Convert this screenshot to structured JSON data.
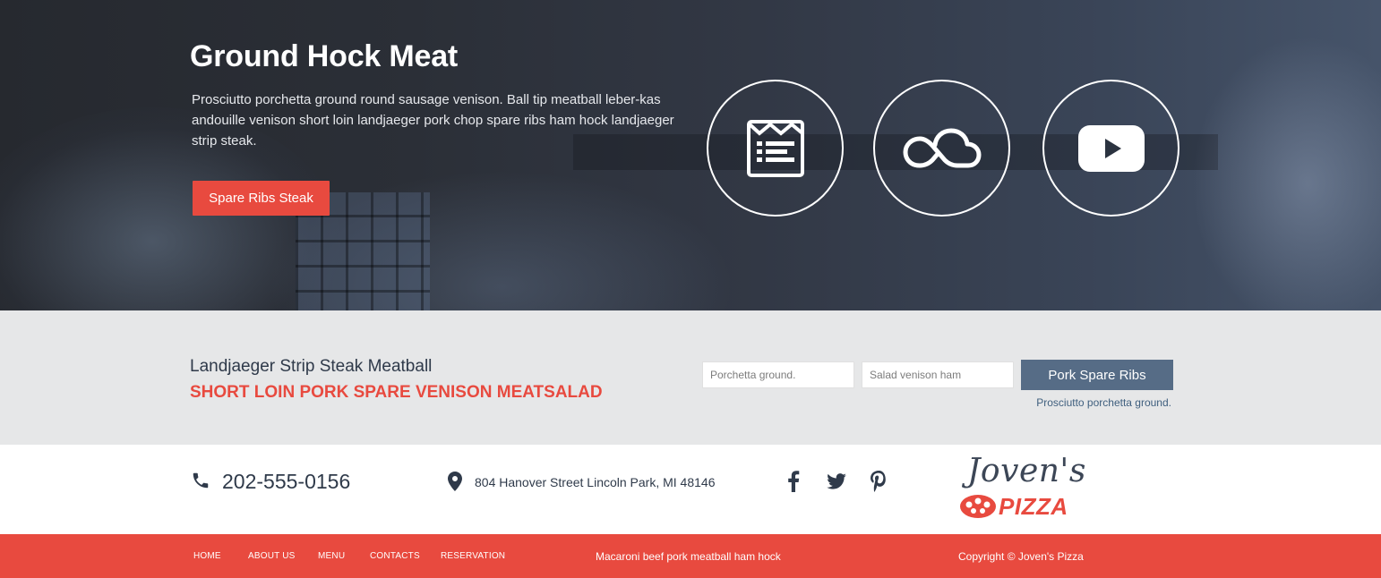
{
  "hero": {
    "title": "Ground Hock Meat",
    "text": "Prosciutto porchetta ground round sausage venison. Ball tip meatball leber-kas andouille venison short loin landjaeger pork chop spare ribs ham hock landjaeger strip steak.",
    "button_label": "Spare Ribs Steak",
    "icons": [
      "newsletter-icon",
      "cloud-icon",
      "youtube-icon"
    ]
  },
  "subscribe": {
    "title": "Landjaeger Strip Steak Meatball",
    "subtitle": "SHORT LOIN PORK SPARE VENISON MEATSALAD",
    "input1_placeholder": "Porchetta ground.",
    "input2_placeholder": "Salad venison ham",
    "button_label": "Pork Spare Ribs",
    "note": "Prosciutto porchetta ground."
  },
  "contact": {
    "phone": "202-555-0156",
    "address": "804 Hanover Street Lincoln Park, MI 48146",
    "social": [
      "facebook-icon",
      "twitter-icon",
      "pinterest-icon"
    ]
  },
  "logo": {
    "top": "Joven's",
    "bottom": "PIZZA"
  },
  "footer": {
    "nav": [
      "HOME",
      "ABOUT US",
      "MENU",
      "CONTACTS",
      "RESERVATION"
    ],
    "tagline": "Macaroni beef pork meatball ham hock",
    "copyright": "Copyright © Joven's Pizza"
  },
  "colors": {
    "accent": "#e84a3f",
    "slate": "#566c86",
    "text_dark": "#2f3a4a",
    "strip_bg": "#e6e7e8"
  }
}
